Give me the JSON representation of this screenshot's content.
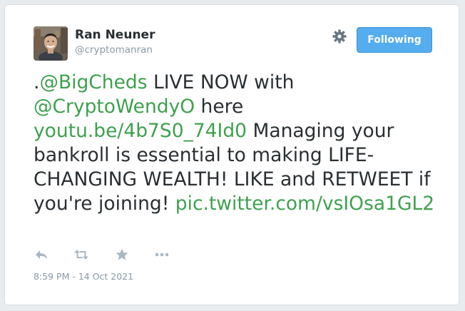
{
  "author": {
    "name": "Ran Neuner",
    "handle": "@cryptomanran"
  },
  "follow_button": {
    "label": "Following",
    "color": "#55acee"
  },
  "tweet": {
    "prefix": ".",
    "mention_1": "@BigCheds",
    "text_1": " LIVE NOW with ",
    "mention_2": "@CryptoWendyO",
    "text_2": " here ",
    "link_1": "youtu.be/4b7S0_74Id0",
    "text_3": " Managing your bankroll is essential to making LIFE-CHANGING WEALTH! LIKE and RETWEET if you're joining! ",
    "link_2": "pic.twitter.com/vsIOsa1GL2",
    "link_color": "#3ea14e"
  },
  "actions": [
    {
      "icon": "reply-icon"
    },
    {
      "icon": "retweet-icon"
    },
    {
      "icon": "favorite-star-icon"
    },
    {
      "icon": "more-icon"
    }
  ],
  "settings_icon": "gear-icon",
  "timestamp": "8:59 PM - 14 Oct 2021"
}
